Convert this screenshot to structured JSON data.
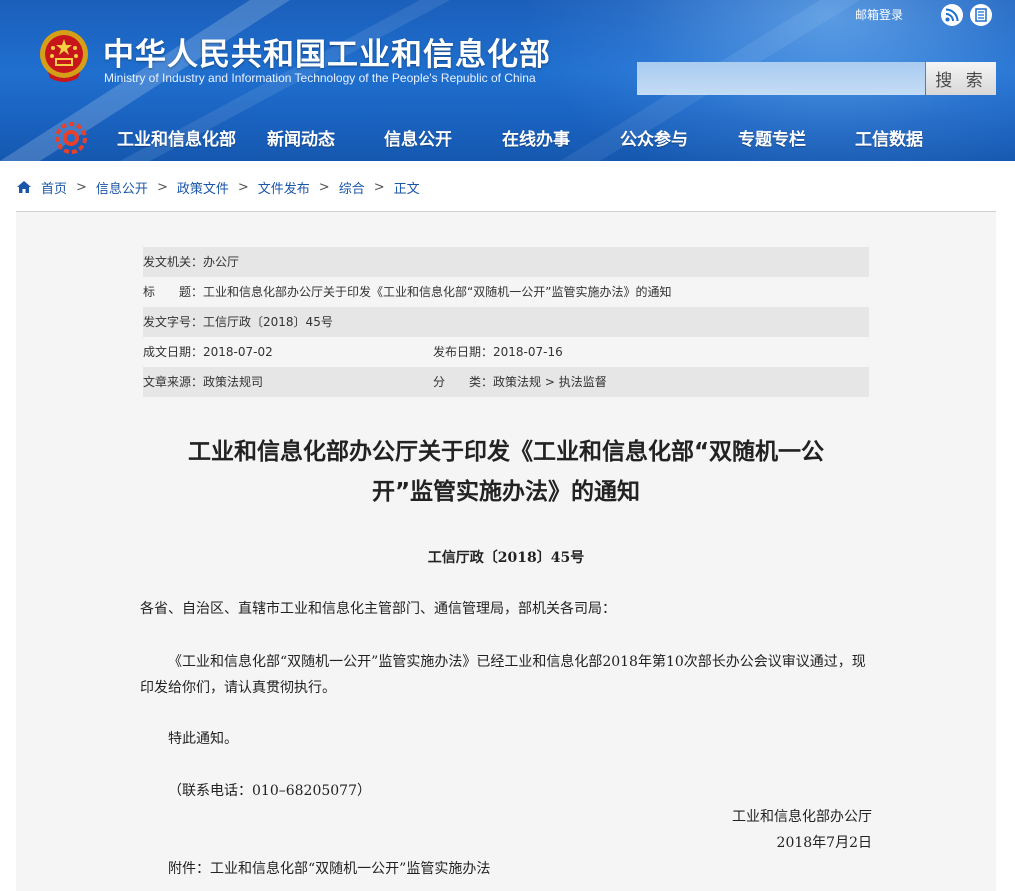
{
  "header": {
    "title_cn": "中华人民共和国工业和信息化部",
    "title_en": "Ministry of Industry and Information Technology of the People's Republic of China",
    "mail_login": "邮箱登录",
    "search_button": "搜 索",
    "search_placeholder": "",
    "icons": [
      "emblem-icon",
      "rss-icon",
      "list-icon",
      "nav-logo-icon"
    ]
  },
  "nav": {
    "items": [
      {
        "label": "工业和信息化部"
      },
      {
        "label": "新闻动态"
      },
      {
        "label": "信息公开"
      },
      {
        "label": "在线办事"
      },
      {
        "label": "公众参与"
      },
      {
        "label": "专题专栏"
      },
      {
        "label": "工信数据"
      }
    ]
  },
  "breadcrumb": {
    "items": [
      "首页",
      "信息公开",
      "政策文件",
      "文件发布",
      "综合",
      "正文"
    ],
    "separator": ">"
  },
  "meta": {
    "issuer_label": "发文机关：",
    "issuer": "办公厅",
    "title_label": "标　　题：",
    "title": "工业和信息化部办公厅关于印发《工业和信息化部“双随机一公开”监管实施办法》的通知",
    "docno_label": "发文字号：",
    "docno": "工信厅政〔2018〕45号",
    "created_label": "成文日期：",
    "created": "2018-07-02",
    "published_label": "发布日期：",
    "published": "2018-07-16",
    "source_label": "文章来源：",
    "source": "政策法规司",
    "category_label": "分　　类：",
    "category": "政策法规 > 执法监督"
  },
  "article": {
    "title_line1": "工业和信息化部办公厅关于印发《工业和信息化部“双随机一公",
    "title_line2": "开”监管实施办法》的通知",
    "doc_number": "工信厅政〔2018〕45号",
    "salutation": "各省、自治区、直辖市工业和信息化主管部门、通信管理局，部机关各司局：",
    "paragraph": "《工业和信息化部“双随机一公开”监管实施办法》已经工业和信息化部2018年第10次部长办公会议审议通过，现印发给你们，请认真贯彻执行。",
    "notice": "特此通知。",
    "contact": "（联系电话：010–68205077）",
    "sign_org": "工业和信息化部办公厅",
    "sign_date": "2018年7月2日",
    "attachment": "附件：工业和信息化部“双随机一公开”监管实施办法"
  },
  "colors": {
    "header_blue": "#1f6fcf",
    "link_blue": "#1a56a8",
    "panel_bg": "#f5f5f5",
    "meta_shade": "#e6e6e6"
  }
}
